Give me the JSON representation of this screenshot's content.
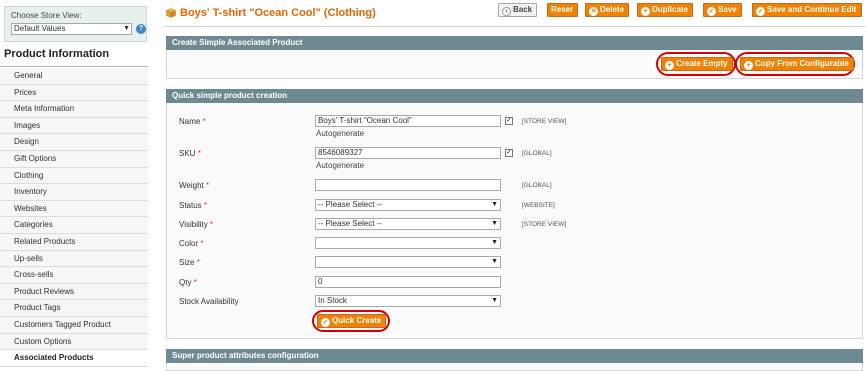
{
  "sidebar": {
    "store_label": "Choose Store View:",
    "store_value": "Default Values",
    "tabs_title": "Product Information",
    "items": [
      {
        "label": "General"
      },
      {
        "label": "Prices"
      },
      {
        "label": "Meta Information"
      },
      {
        "label": "Images"
      },
      {
        "label": "Design"
      },
      {
        "label": "Gift Options"
      },
      {
        "label": "Clothing"
      },
      {
        "label": "Inventory"
      },
      {
        "label": "Websites"
      },
      {
        "label": "Categories"
      },
      {
        "label": "Related Products"
      },
      {
        "label": "Up-sells"
      },
      {
        "label": "Cross-sells"
      },
      {
        "label": "Product Reviews"
      },
      {
        "label": "Product Tags"
      },
      {
        "label": "Customers Tagged Product"
      },
      {
        "label": "Custom Options"
      },
      {
        "label": "Associated Products"
      }
    ]
  },
  "header": {
    "title": "Boys' T-shirt \"Ocean Cool\" (Clothing)",
    "back": "Back",
    "reset": "Reset",
    "delete": "Delete",
    "duplicate": "Duplicate",
    "save": "Save",
    "save_continue": "Save and Continue Edit"
  },
  "create_panel": {
    "title": "Create Simple Associated Product",
    "create_empty": "Create Empty",
    "copy_from_configurable": "Copy From Configurable"
  },
  "quick_panel": {
    "title": "Quick simple product creation",
    "name_label": "Name",
    "name_value": "Boys' T-shirt \"Ocean Cool\"",
    "name_scope": "[STORE VIEW]",
    "autogenerate": "Autogenerate",
    "sku_label": "SKU",
    "sku_value": "8546089327",
    "sku_scope": "[GLOBAL]",
    "weight_label": "Weight",
    "weight_value": "",
    "weight_scope": "[GLOBAL]",
    "status_label": "Status",
    "status_value": "-- Please Select --",
    "status_scope": "[WEBSITE]",
    "visibility_label": "Visibility",
    "visibility_value": "-- Please Select --",
    "visibility_scope": "[STORE VIEW]",
    "color_label": "Color",
    "color_value": "",
    "size_label": "Size",
    "size_value": "",
    "qty_label": "Qty",
    "qty_value": "0",
    "stock_label": "Stock Availability",
    "stock_value": "In Stock",
    "quick_create": "Quick Create",
    "required_mark": "*"
  },
  "super_panel": {
    "title": "Super product attributes configuration"
  },
  "colors": {
    "accent": "#f18200",
    "title": "#e26703",
    "panel_header": "#6f8992",
    "highlight": "#d40000"
  }
}
